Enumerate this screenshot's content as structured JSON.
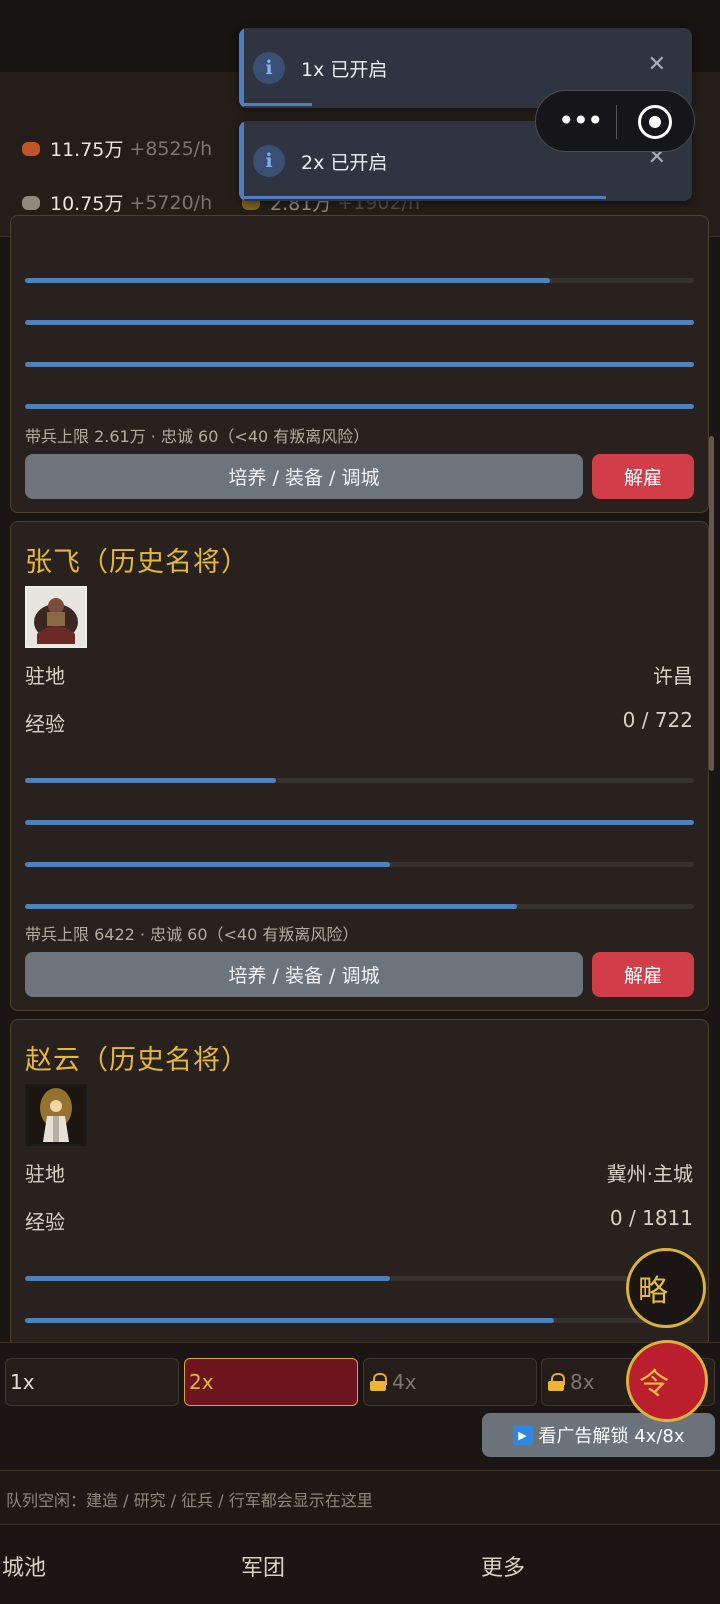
{
  "resources": {
    "r1": {
      "value": "11.75万",
      "rate": "+8525/h",
      "icon": "food-icon",
      "color": "#c0542a"
    },
    "r2": {
      "value": "10.75万",
      "rate": "+5720/h",
      "icon": "stone-icon",
      "color": "#8f8a80"
    },
    "r3": {
      "value": "2.81万",
      "rate": "+1902/h",
      "icon": "gold-icon",
      "color": "#c99a2e"
    }
  },
  "toasts": [
    {
      "text": "1x 已开启",
      "progress": 0.15
    },
    {
      "text": "2x 已开启",
      "progress": 0.8
    }
  ],
  "capsule": {
    "more": "•••"
  },
  "generals": [
    {
      "name": "",
      "bars": [
        0.785,
        1.0,
        1.0,
        1.0
      ],
      "footer": "带兵上限 2.61万 · 忠诚 60（<40 有叛离风险）",
      "action_label": "培养 / 装备 / 调城",
      "dismiss_label": "解雇"
    },
    {
      "name": "张飞（历史名将）",
      "station_label": "驻地",
      "station_value": "许昌",
      "exp_label": "经验",
      "exp_value": "0 / 722",
      "bars": [
        0.375,
        1.0,
        0.545,
        0.735
      ],
      "footer": "带兵上限 6422 · 忠诚 60（<40 有叛离风险）",
      "action_label": "培养 / 装备 / 调城",
      "dismiss_label": "解雇"
    },
    {
      "name": "赵云（历史名将）",
      "station_label": "驻地",
      "station_value": "冀州·主城",
      "exp_label": "经验",
      "exp_value": "0 / 1811",
      "bars": [
        0.545,
        0.79
      ]
    }
  ],
  "speed": {
    "s1": "1x",
    "s2": "2x",
    "s4": "4x",
    "s8": "8x",
    "active": "2x"
  },
  "ad_button": "看广告解锁 4x/8x",
  "fab": {
    "strategy": "略",
    "command": "令"
  },
  "queue_status": "队列空闲：建造 / 研究 / 征兵 / 行军都会显示在这里",
  "tabs": {
    "city": "城池",
    "army": "军团",
    "more": "更多"
  },
  "colors": {
    "accent_gold": "#e3b83f",
    "progress_blue": "#4d82bd",
    "danger_red": "#d23d4a"
  }
}
